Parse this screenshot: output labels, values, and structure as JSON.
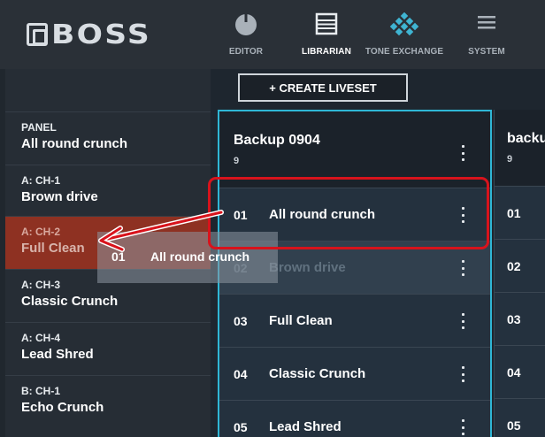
{
  "header": {
    "logo_text": "BOSS",
    "nav": [
      {
        "label": "EDITOR",
        "icon": "knob-icon"
      },
      {
        "label": "LIBRARIAN",
        "icon": "list-icon",
        "active": true
      },
      {
        "label": "TONE EXCHANGE",
        "icon": "diamond-grid-icon"
      },
      {
        "label": "SYSTEM",
        "icon": "hamburger-icon"
      }
    ]
  },
  "sidebar": {
    "items": [
      {
        "top": "PANEL",
        "name": "All round crunch"
      },
      {
        "top": "A: CH-1",
        "name": "Brown drive"
      },
      {
        "top": "A: CH-2",
        "name": "Full Clean",
        "selected": true
      },
      {
        "top": "A: CH-3",
        "name": "Classic Crunch"
      },
      {
        "top": "A: CH-4",
        "name": "Lead Shred"
      },
      {
        "top": "B: CH-1",
        "name": "Echo Crunch"
      }
    ]
  },
  "main": {
    "create_button": "+ CREATE LIVESET",
    "columns": [
      {
        "title": "Backup 0904",
        "count": "9",
        "rows": [
          {
            "num": "01",
            "name": "All round crunch"
          },
          {
            "num": "02",
            "name": "Brown drive"
          },
          {
            "num": "03",
            "name": "Full Clean"
          },
          {
            "num": "04",
            "name": "Classic Crunch"
          },
          {
            "num": "05",
            "name": "Lead Shred"
          }
        ]
      },
      {
        "title": "backu",
        "count": "9",
        "rows": [
          {
            "num": "01"
          },
          {
            "num": "02"
          },
          {
            "num": "03"
          },
          {
            "num": "04"
          },
          {
            "num": "05"
          }
        ]
      }
    ]
  },
  "drag": {
    "num": "01",
    "name": "All round crunch"
  },
  "colors": {
    "accent": "#2fb7d6",
    "selected": "#8e3122",
    "annotation": "#d8131c"
  }
}
